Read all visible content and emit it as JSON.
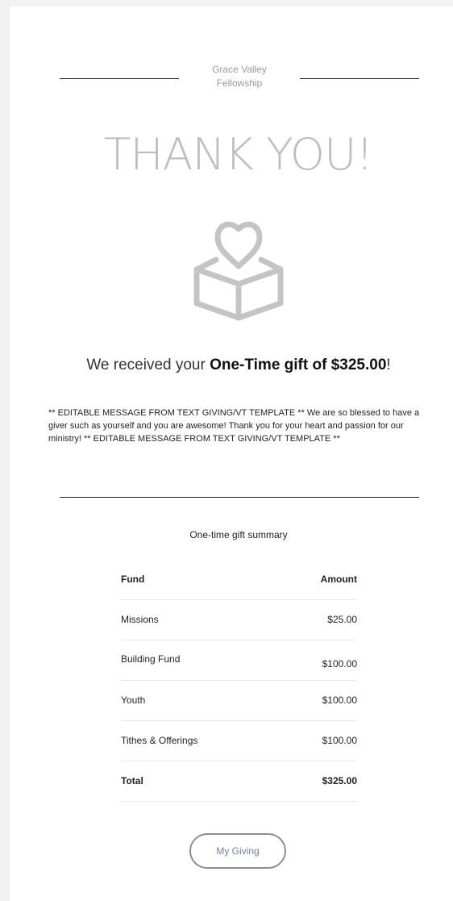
{
  "header": {
    "org_line1": "Grace Valley",
    "org_line2": "Fellowship"
  },
  "hero": {
    "title": "THANK YOU!",
    "icon": "heart-box-icon"
  },
  "receipt": {
    "prefix": "We received your ",
    "emphasis": "One-Time gift of $325.00",
    "suffix": "!"
  },
  "message": "** EDITABLE MESSAGE FROM TEXT GIVING/VT TEMPLATE ** We are so blessed to have a giver such as yourself and you are awesome! Thank you for your heart and passion for our ministry! ** EDITABLE MESSAGE FROM TEXT GIVING/VT TEMPLATE **",
  "summary": {
    "title": "One-time gift summary",
    "headers": {
      "fund": "Fund",
      "amount": "Amount"
    },
    "rows": [
      {
        "fund": "Missions",
        "amount": "$25.00"
      },
      {
        "fund": "Building Fund",
        "amount": "$100.00"
      },
      {
        "fund": "Youth",
        "amount": "$100.00"
      },
      {
        "fund": "Tithes & Offerings",
        "amount": "$100.00"
      }
    ],
    "total": {
      "label": "Total",
      "amount": "$325.00"
    }
  },
  "actions": {
    "my_giving": "My Giving"
  },
  "colors": {
    "title": "#bdbdbd",
    "icon": "#c4c4c4",
    "button_border": "#8c8c98",
    "button_text": "#6e7e9a"
  }
}
